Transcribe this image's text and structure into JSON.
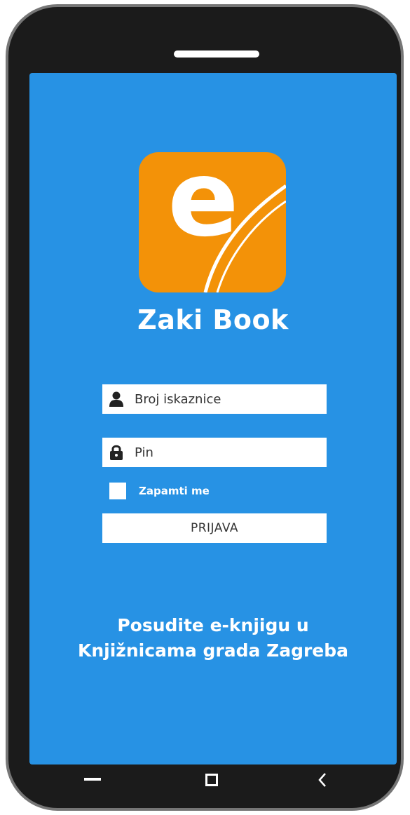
{
  "app": {
    "title": "Zaki Book",
    "logo_letter": "e",
    "logo_color": "#f39208",
    "background_color": "#2792e4"
  },
  "login": {
    "card_number_placeholder": "Broj iskaznice",
    "card_number_value": "",
    "pin_placeholder": "Pin",
    "pin_value": "",
    "remember_label": "Zapamti me",
    "remember_checked": false,
    "submit_label": "PRIJAVA"
  },
  "tagline": {
    "line1": "Posudite e-knjigu u",
    "line2": "Knjižnicama grada Zagreba"
  },
  "navbar": {
    "icons": [
      "minimize-icon",
      "square-icon",
      "back-chevron-icon"
    ]
  }
}
